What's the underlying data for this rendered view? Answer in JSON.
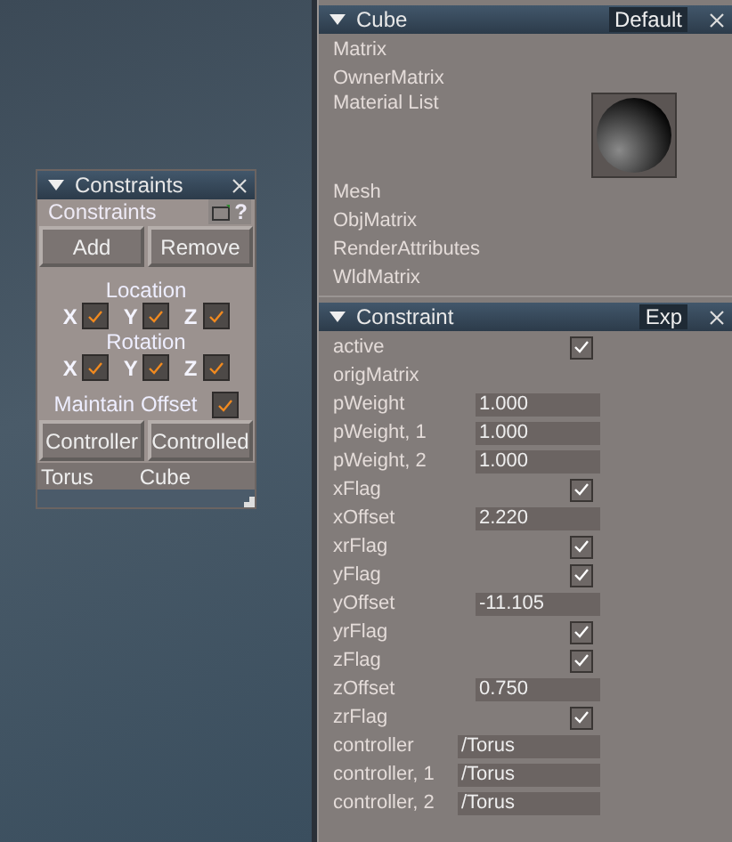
{
  "constraints_window": {
    "title": "Constraints",
    "heading": "Constraints",
    "help": "?",
    "top_buttons": [
      "Add",
      "Remove"
    ],
    "groups": [
      {
        "label": "Location",
        "axes": [
          {
            "label": "X",
            "checked": true
          },
          {
            "label": "Y",
            "checked": true
          },
          {
            "label": "Z",
            "checked": true
          }
        ]
      },
      {
        "label": "Rotation",
        "axes": [
          {
            "label": "X",
            "checked": true
          },
          {
            "label": "Y",
            "checked": true
          },
          {
            "label": "Z",
            "checked": true
          }
        ]
      }
    ],
    "maintain_offset": {
      "label": "Maintain Offset",
      "checked": true
    },
    "bottom_buttons": [
      "Controller",
      "Controlled"
    ],
    "footer": [
      "Torus",
      "Cube"
    ]
  },
  "cube_panel": {
    "title": "Cube",
    "mode": "Default",
    "items": [
      {
        "label": "Matrix",
        "kind": "label"
      },
      {
        "label": "OwnerMatrix",
        "kind": "label"
      },
      {
        "label": "Material List",
        "kind": "material"
      },
      {
        "label": "Mesh",
        "kind": "label"
      },
      {
        "label": "ObjMatrix",
        "kind": "label"
      },
      {
        "label": "RenderAttributes",
        "kind": "label"
      },
      {
        "label": "WldMatrix",
        "kind": "label"
      }
    ]
  },
  "constraint_panel": {
    "title": "Constraint",
    "mode": "Exp",
    "rows": [
      {
        "label": "active",
        "kind": "check",
        "checked": true
      },
      {
        "label": "origMatrix",
        "kind": "label"
      },
      {
        "label": "pWeight",
        "kind": "number",
        "value": "1.000"
      },
      {
        "label": "pWeight, 1",
        "kind": "number",
        "value": "1.000"
      },
      {
        "label": "pWeight, 2",
        "kind": "number",
        "value": "1.000"
      },
      {
        "label": "xFlag",
        "kind": "check",
        "checked": true
      },
      {
        "label": "xOffset",
        "kind": "number",
        "value": "2.220"
      },
      {
        "label": "xrFlag",
        "kind": "check",
        "checked": true
      },
      {
        "label": "yFlag",
        "kind": "check",
        "checked": true
      },
      {
        "label": "yOffset",
        "kind": "number",
        "value": "-11.105"
      },
      {
        "label": "yrFlag",
        "kind": "check",
        "checked": true
      },
      {
        "label": "zFlag",
        "kind": "check",
        "checked": true
      },
      {
        "label": "zOffset",
        "kind": "number",
        "value": "0.750"
      },
      {
        "label": "zrFlag",
        "kind": "check",
        "checked": true
      },
      {
        "label": "controller",
        "kind": "text",
        "value": "/Torus"
      },
      {
        "label": "controller, 1",
        "kind": "text",
        "value": "/Torus"
      },
      {
        "label": "controller, 2",
        "kind": "text",
        "value": "/Torus"
      }
    ]
  }
}
